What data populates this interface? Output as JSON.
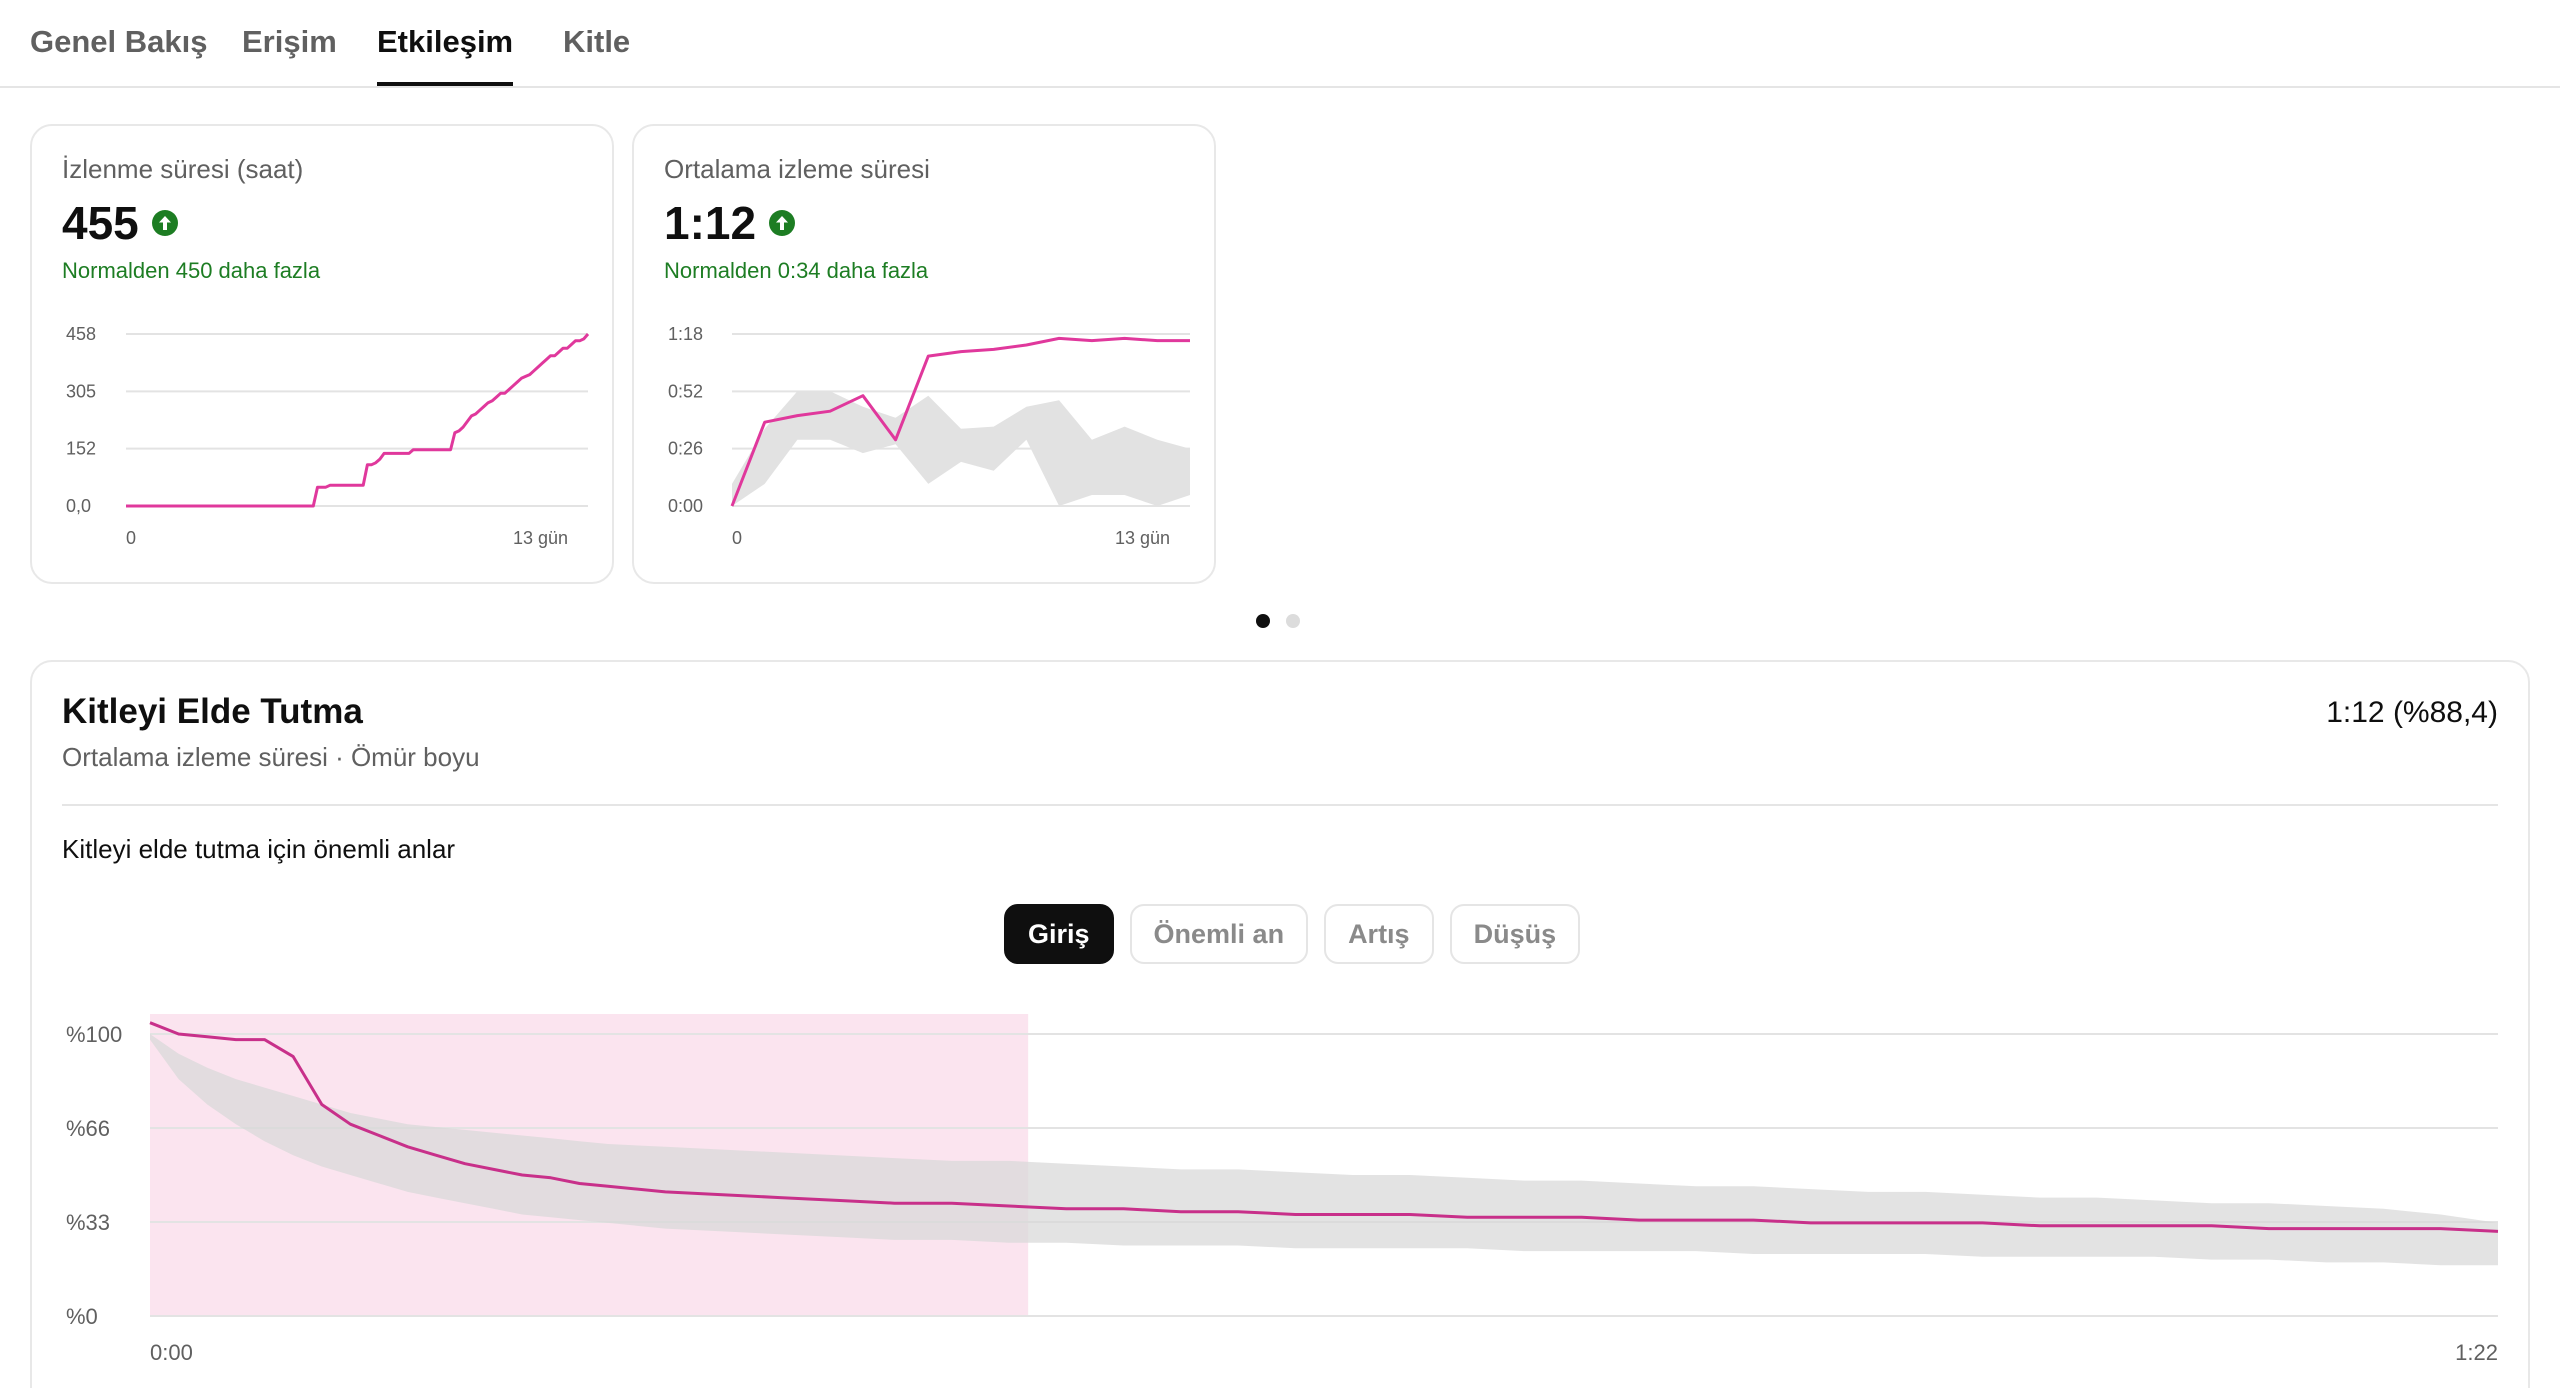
{
  "tabs": [
    {
      "label": "Genel Bakış",
      "active": false
    },
    {
      "label": "Erişim",
      "active": false
    },
    {
      "label": "Etkileşim",
      "active": true
    },
    {
      "label": "Kitle",
      "active": false
    }
  ],
  "cards": [
    {
      "title": "İzlenme süresi (saat)",
      "value": "455",
      "note": "Normalden 450 daha fazla",
      "chart_data": {
        "type": "line",
        "y_ticks": [
          "458",
          "305",
          "152",
          "0,0"
        ],
        "x_ticks": [
          "0",
          "13 gün"
        ],
        "ylim": [
          0,
          458
        ],
        "series": [
          {
            "values": [
              0,
              0,
              0,
              0,
              0,
              0,
              0,
              0,
              0,
              0,
              0,
              0,
              0,
              0,
              0,
              0,
              0,
              0,
              0,
              0,
              0,
              0,
              0,
              0,
              0,
              0,
              0,
              0,
              0,
              0,
              0,
              0,
              0,
              0,
              0,
              0,
              0,
              0,
              0,
              0,
              0,
              0,
              0,
              0,
              0,
              0,
              50,
              50,
              50,
              55,
              55,
              55,
              55,
              55,
              55,
              55,
              55,
              55,
              110,
              110,
              115,
              125,
              140,
              140,
              140,
              140,
              140,
              140,
              140,
              150,
              150,
              150,
              150,
              150,
              150,
              150,
              150,
              150,
              150,
              195,
              200,
              210,
              225,
              240,
              245,
              255,
              265,
              275,
              280,
              290,
              300,
              300,
              310,
              320,
              330,
              340,
              345,
              350,
              360,
              370,
              380,
              390,
              400,
              400,
              410,
              420,
              420,
              430,
              440,
              440,
              445,
              458
            ]
          }
        ]
      }
    },
    {
      "title": "Ortalama izleme süresi",
      "value": "1:12",
      "note": "Normalden 0:34 daha fazla",
      "chart_data": {
        "type": "line",
        "y_ticks": [
          "1:18",
          "0:52",
          "0:26",
          "0:00"
        ],
        "x_ticks": [
          "0",
          "13 gün"
        ],
        "ylim": [
          0,
          78
        ],
        "series": [
          {
            "values": [
              0,
              38,
              41,
              43,
              50,
              30,
              68,
              70,
              71,
              73,
              76,
              75,
              76,
              75,
              75
            ]
          },
          {
            "band_high": [
              10,
              35,
              52,
              52,
              45,
              40,
              50,
              35,
              36,
              45,
              48,
              30,
              36,
              30,
              26
            ],
            "band_low": [
              0,
              10,
              30,
              30,
              24,
              28,
              10,
              20,
              16,
              30,
              0,
              5,
              5,
              0,
              5
            ]
          }
        ]
      }
    }
  ],
  "pagination": {
    "count": 2,
    "active": 0
  },
  "retention": {
    "title": "Kitleyi Elde Tutma",
    "subtitle": "Ortalama izleme süresi · Ömür boyu",
    "right_value": "1:12 (%88,4)",
    "moments_label": "Kitleyi elde tutma için önemli anlar",
    "chips": [
      {
        "label": "Giriş",
        "active": true
      },
      {
        "label": "Önemli an",
        "active": false
      },
      {
        "label": "Artış",
        "active": false
      },
      {
        "label": "Düşüş",
        "active": false
      }
    ],
    "chart_data": {
      "type": "line",
      "y_ticks": [
        "%100",
        "%66",
        "%33",
        "%0"
      ],
      "x_ticks": [
        "0:00",
        "1:22"
      ],
      "ylim": [
        0,
        100
      ],
      "highlight_fraction": [
        0,
        0.374
      ],
      "x": [
        0,
        1,
        2,
        3,
        4,
        5,
        6,
        7,
        8,
        9,
        10,
        11,
        12,
        13,
        14,
        15,
        16,
        18,
        20,
        22,
        24,
        26,
        28,
        30,
        32,
        34,
        36,
        38,
        40,
        42,
        44,
        46,
        48,
        50,
        52,
        54,
        56,
        58,
        60,
        62,
        64,
        66,
        68,
        70,
        72,
        74,
        76,
        78,
        80,
        82
      ],
      "series": [
        {
          "values": [
            104,
            100,
            99,
            98,
            98,
            92,
            75,
            68,
            64,
            60,
            57,
            54,
            52,
            50,
            49,
            47,
            46,
            44,
            43,
            42,
            41,
            40,
            40,
            39,
            38,
            38,
            37,
            37,
            36,
            36,
            36,
            35,
            35,
            35,
            34,
            34,
            34,
            33,
            33,
            33,
            33,
            32,
            32,
            32,
            32,
            31,
            31,
            31,
            31,
            30
          ]
        },
        {
          "band_high": [
            100,
            93,
            88,
            84,
            81,
            78,
            75,
            72,
            70,
            68,
            67,
            66,
            65,
            64,
            63,
            62,
            61,
            60,
            59,
            58,
            57,
            56,
            55,
            55,
            54,
            53,
            52,
            52,
            51,
            50,
            50,
            49,
            48,
            48,
            47,
            46,
            46,
            45,
            44,
            44,
            43,
            42,
            42,
            41,
            40,
            40,
            39,
            38,
            36,
            33
          ],
          "band_low": [
            98,
            84,
            75,
            68,
            62,
            57,
            53,
            50,
            47,
            44,
            42,
            40,
            38,
            36,
            35,
            34,
            33,
            31,
            30,
            29,
            28,
            27,
            27,
            26,
            26,
            25,
            25,
            25,
            24,
            24,
            24,
            24,
            23,
            23,
            23,
            23,
            22,
            22,
            22,
            22,
            21,
            21,
            21,
            21,
            20,
            20,
            19,
            19,
            18,
            18
          ]
        }
      ]
    }
  },
  "colors": {
    "line": "#e0389c",
    "retention_line": "#c8308a",
    "band": "#e2e2e2",
    "highlight": "#fbe4ef",
    "positive": "#1d7d23"
  }
}
